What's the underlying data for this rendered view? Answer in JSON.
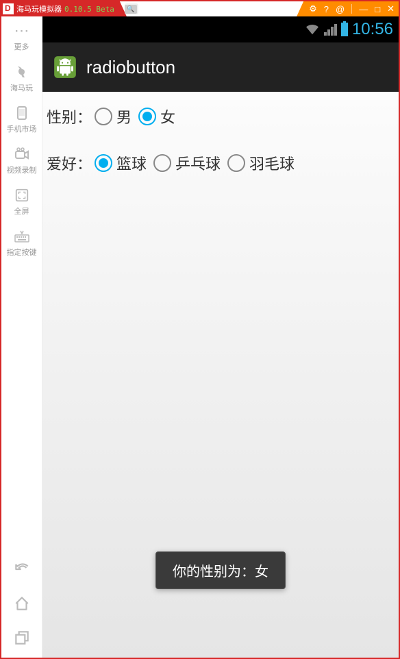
{
  "titlebar": {
    "app_name": "海马玩模拟器",
    "version": "0.10.5 Beta"
  },
  "sidebar": {
    "items": [
      {
        "icon": "more",
        "label": "更多"
      },
      {
        "icon": "horse",
        "label": "海马玩"
      },
      {
        "icon": "market",
        "label": "手机市场"
      },
      {
        "icon": "record",
        "label": "视频录制"
      },
      {
        "icon": "fullscreen",
        "label": "全屏"
      },
      {
        "icon": "keymap",
        "label": "指定按键"
      }
    ]
  },
  "status": {
    "time": "10:56"
  },
  "app": {
    "title": "radiobutton"
  },
  "form": {
    "gender_label": "性别：",
    "gender_options": [
      "男",
      "女"
    ],
    "gender_selected": 1,
    "hobby_label": "爱好：",
    "hobby_options": [
      "篮球",
      "乒乓球",
      "羽毛球"
    ],
    "hobby_selected": 0
  },
  "toast": {
    "text": "你的性别为：女"
  }
}
